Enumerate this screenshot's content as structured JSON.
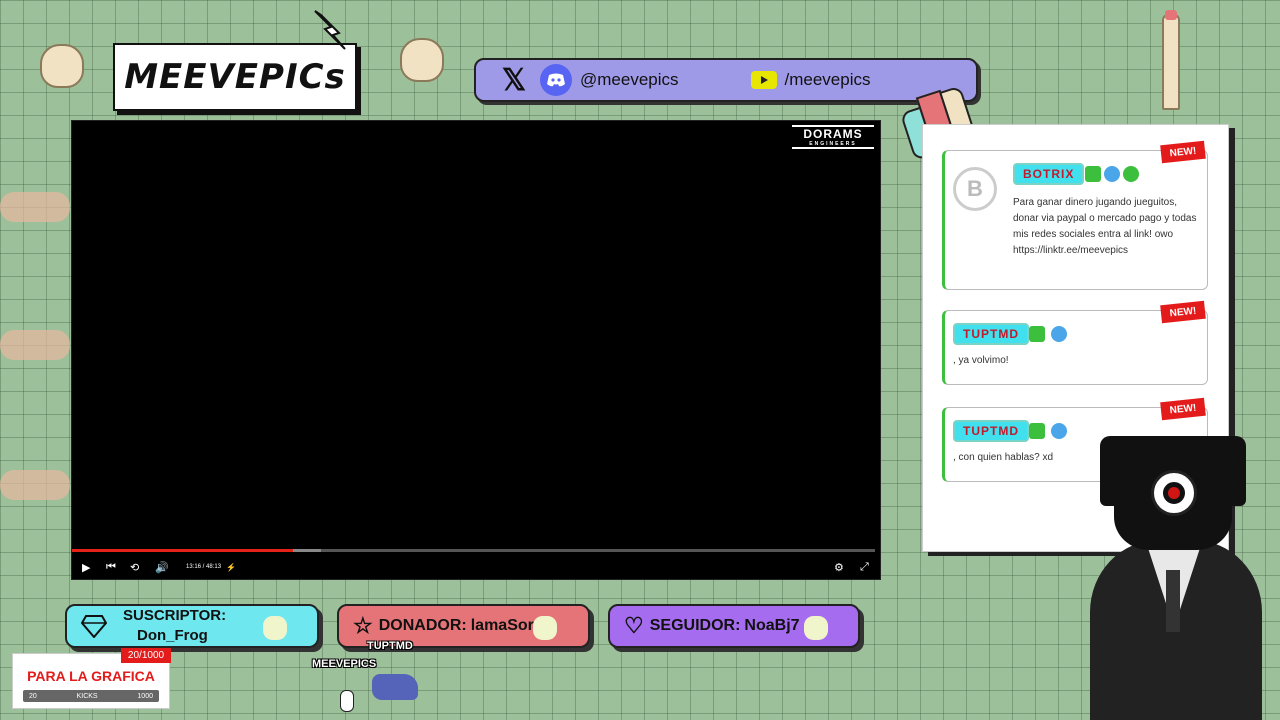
{
  "logo": {
    "text": "MEEVEPICs"
  },
  "social": {
    "discord_handle": "@meevepics",
    "youtube_handle": "/meevepics"
  },
  "player": {
    "brand": "DORAMS",
    "brand_sub": "ENGINEERS",
    "time": "13:16 / 48:13",
    "progress": 0.275,
    "buffered": 0.31
  },
  "alerts": {
    "sub_label": "SUSCRIPTOR:",
    "sub_name": "Don_Frog",
    "donor_label": "DONADOR:",
    "donor_name": "lamaSor",
    "follower_label": "SEGUIDOR:",
    "follower_name": "NoaBj7"
  },
  "chat": {
    "messages": [
      {
        "user": "BOTRIX",
        "badge": "NEW!",
        "text": "Para ganar dinero jugando jueguitos, donar via paypal o mercado pago y todas mis redes sociales entra al link! owo https://linktr.ee/meevepics"
      },
      {
        "user": "TUPTMD",
        "badge": "NEW!",
        "text": ", ya volvimo!"
      },
      {
        "user": "TUPTMD",
        "badge": "NEW!",
        "text": ", con quien hablas? xd"
      }
    ]
  },
  "goal": {
    "count": "20/1000",
    "title": "PARA LA GRAFICA",
    "min": "20",
    "unit": "KICKS",
    "max": "1000",
    "progress": 0.02
  },
  "sprites": {
    "label1": "TUPTMD",
    "label2": "MEEVEPICS"
  },
  "colors": {
    "background": "#9cc09a",
    "social_bar": "#9f9ae8",
    "sub_alert": "#6ee7ef",
    "donor_alert": "#e57478",
    "follower_alert": "#a66cf0",
    "accent_red": "#e41b1b",
    "chat_name_bg": "#41e0ee"
  },
  "icons": [
    "x-icon",
    "discord-icon",
    "youtube-icon",
    "diamond-icon",
    "star-icon",
    "heart-icon",
    "play-icon",
    "settings-icon",
    "fullscreen-icon"
  ]
}
